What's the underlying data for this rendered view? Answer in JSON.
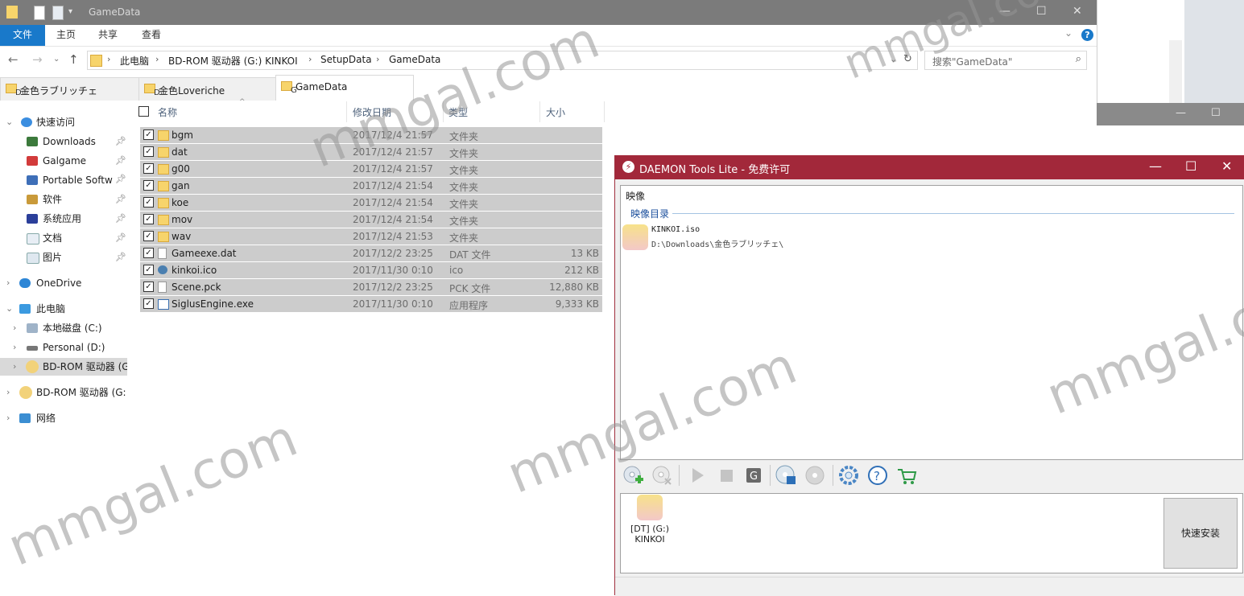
{
  "explorer": {
    "title": "GameData",
    "ribbon_tabs": [
      "文件",
      "主页",
      "共享",
      "查看"
    ],
    "address": [
      "此电脑",
      "BD-ROM 驱动器 (G:) KINKOI",
      "SetupData",
      "GameData"
    ],
    "search_placeholder": "搜索\"GameData\"",
    "folder_tabs": [
      {
        "label": "金色ラブリッチェ",
        "letter": "D"
      },
      {
        "label": "金色Loveriche",
        "letter": "D"
      },
      {
        "label": "GameData",
        "letter": "G"
      }
    ],
    "nav": {
      "quick_access": "快速访问",
      "quick_items": [
        "Downloads",
        "Galgame",
        "Portable Softw",
        "软件",
        "系统应用",
        "文档",
        "图片"
      ],
      "onedrive": "OneDrive",
      "this_pc": "此电脑",
      "pc_items": [
        "本地磁盘 (C:)",
        "Personal (D:)",
        "BD-ROM 驱动器 (G"
      ],
      "bd_rom": "BD-ROM 驱动器 (G:",
      "network": "网络"
    },
    "columns": {
      "name": "名称",
      "date": "修改日期",
      "type": "类型",
      "size": "大小"
    },
    "files": [
      {
        "name": "bgm",
        "date": "2017/12/4 21:57",
        "type": "文件夹",
        "size": "",
        "kind": "folder"
      },
      {
        "name": "dat",
        "date": "2017/12/4 21:57",
        "type": "文件夹",
        "size": "",
        "kind": "folder"
      },
      {
        "name": "g00",
        "date": "2017/12/4 21:57",
        "type": "文件夹",
        "size": "",
        "kind": "folder"
      },
      {
        "name": "gan",
        "date": "2017/12/4 21:54",
        "type": "文件夹",
        "size": "",
        "kind": "folder"
      },
      {
        "name": "koe",
        "date": "2017/12/4 21:54",
        "type": "文件夹",
        "size": "",
        "kind": "folder"
      },
      {
        "name": "mov",
        "date": "2017/12/4 21:54",
        "type": "文件夹",
        "size": "",
        "kind": "folder"
      },
      {
        "name": "wav",
        "date": "2017/12/4 21:53",
        "type": "文件夹",
        "size": "",
        "kind": "folder"
      },
      {
        "name": "Gameexe.dat",
        "date": "2017/12/2 23:25",
        "type": "DAT 文件",
        "size": "13 KB",
        "kind": "file"
      },
      {
        "name": "kinkoi.ico",
        "date": "2017/11/30 0:10",
        "type": "ico",
        "size": "212 KB",
        "kind": "ico"
      },
      {
        "name": "Scene.pck",
        "date": "2017/12/2 23:25",
        "type": "PCK 文件",
        "size": "12,880 KB",
        "kind": "file"
      },
      {
        "name": "SiglusEngine.exe",
        "date": "2017/11/30 0:10",
        "type": "应用程序",
        "size": "9,333 KB",
        "kind": "exe"
      }
    ]
  },
  "daemon": {
    "title": "DAEMON Tools Lite - 免费许可",
    "images_label": "映像",
    "catalog_label": "映像目录",
    "image_name": "KINKOI.iso",
    "image_path": "D:\\Downloads\\金色ラブリッチェ\\",
    "drive_label_line1": "[DT] (G:)",
    "drive_label_line2": "KINKOI",
    "quick_install": "快速安装",
    "toolbar_icons": [
      "add-image-icon",
      "remove-image-icon",
      "play-icon",
      "stop-icon",
      "grab-icon",
      "write-disc-icon",
      "disc-icon",
      "settings-icon",
      "help-icon",
      "cart-icon"
    ]
  },
  "watermark": "mmgal.com",
  "colors": {
    "daemon_title": "#a2283a",
    "ribbon_file": "#1979ca",
    "selection": "#cccccc",
    "title_gray": "#7b7b7b"
  }
}
